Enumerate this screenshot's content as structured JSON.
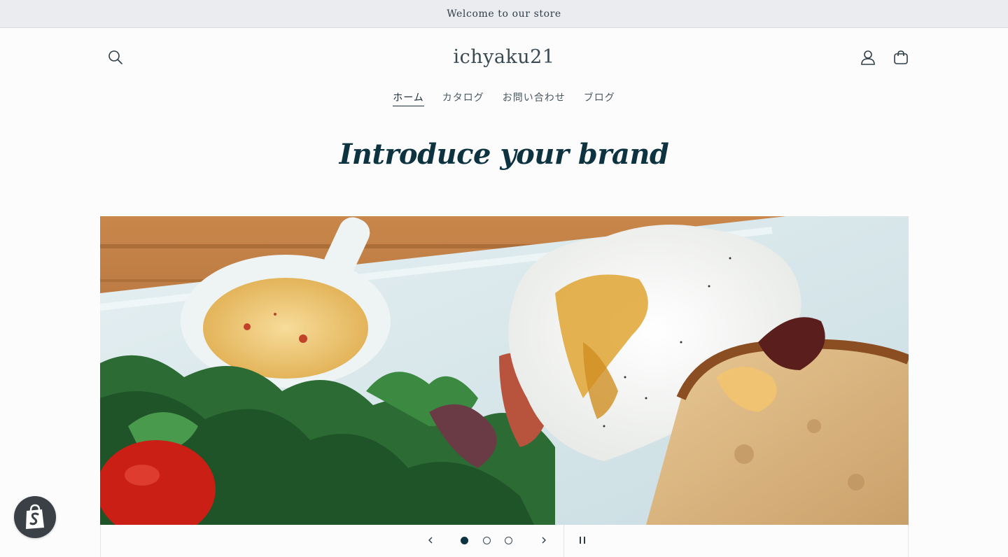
{
  "announcement": {
    "text": "Welcome to our store"
  },
  "header": {
    "logo_text": "ichyaku21",
    "icons": {
      "search": "search-icon",
      "account": "account-icon",
      "cart": "cart-icon"
    }
  },
  "nav": {
    "items": [
      {
        "label": "ホーム",
        "active": true
      },
      {
        "label": "カタログ",
        "active": false
      },
      {
        "label": "お問い合わせ",
        "active": false
      },
      {
        "label": "ブログ",
        "active": false
      }
    ]
  },
  "hero": {
    "title": "Introduce your brand"
  },
  "slideshow": {
    "slide_count": 3,
    "active_slide": 1,
    "image_subject": "breakfast plate with poached eggs, toast, salad and sauce"
  },
  "colors": {
    "accent": "#0d3340",
    "announcement_bg": "#eaecef",
    "page_bg": "#fcfcfd",
    "badge_bg": "#3a4046"
  }
}
